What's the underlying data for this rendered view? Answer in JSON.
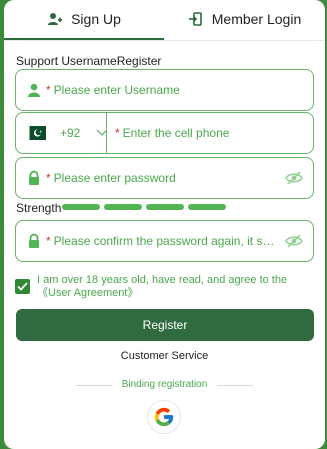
{
  "tabs": {
    "signup_label": "Sign Up",
    "member_login_label": "Member Login"
  },
  "section": {
    "label": "Support UsernameRegister"
  },
  "fields": {
    "username_placeholder": "Please enter Username",
    "phone": {
      "country_code": "+92",
      "placeholder": "Enter the cell phone"
    },
    "password_placeholder": "Please enter password",
    "confirm_password_placeholder": "Please confirm the password again, it should be..."
  },
  "strength": {
    "label": "Strength"
  },
  "agreement": {
    "text": "I am over 18 years old, have read, and agree to the《User Agreement》"
  },
  "actions": {
    "register_label": "Register",
    "customer_service_label": "Customer Service",
    "binding_label": "Binding registration"
  },
  "colors": {
    "brand_green": "#2f6b3f",
    "accent_green": "#4ba84c",
    "required_red": "#d33a3a"
  },
  "icons": [
    "user-add-icon",
    "login-icon",
    "user-icon",
    "pakistan-flag-icon",
    "chevron-down-icon",
    "lock-icon",
    "eye-off-icon",
    "check-icon",
    "google-icon"
  ]
}
